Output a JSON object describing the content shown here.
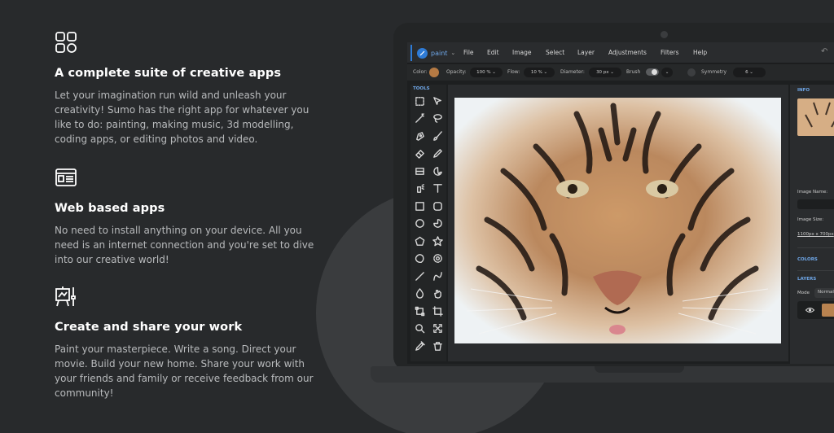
{
  "features": [
    {
      "icon": "grid-apps-icon",
      "title": "A complete suite of creative apps",
      "text": "Let your imagination run wild and unleash your creativity! Sumo has the right app for whatever you like to do: painting, making music, 3d modelling, coding apps, or editing photos and video."
    },
    {
      "icon": "browser-window-icon",
      "title": "Web based apps",
      "text": "No need to install anything on your device. All you need is an internet connection and you're set to dive into our creative world!"
    },
    {
      "icon": "easel-brush-icon",
      "title": "Create and share your work",
      "text": "Paint your masterpiece. Write a song. Direct your movie. Build your new home. Share your work with your friends and family or receive feedback from our community!"
    }
  ],
  "app": {
    "name": "paint",
    "menu": [
      "File",
      "Edit",
      "Image",
      "Select",
      "Layer",
      "Adjustments",
      "Filters",
      "Help"
    ]
  },
  "options": {
    "color_label": "Color:",
    "color": "#b57a44",
    "opacity_label": "Opacity:",
    "opacity_value": "100",
    "flow_label": "Flow:",
    "flow_value": "10",
    "diameter_label": "Diameter:",
    "diameter_value": "30",
    "brush_label": "Brush",
    "symmetry_label": "Symmetry",
    "symmetry_value": "6"
  },
  "tools_title": "TOOLS",
  "tools": [
    "marquee-select-icon",
    "pointer-arrow-icon",
    "magic-wand-icon",
    "lasso-icon",
    "pen-nib-icon",
    "paintbrush-icon",
    "eraser-icon",
    "pencil-icon",
    "gradient-icon",
    "palette-fill-icon",
    "spray-icon",
    "text-tool-icon",
    "rectangle-icon",
    "rounded-rectangle-icon",
    "ellipse-icon",
    "pie-shape-icon",
    "pentagon-icon",
    "star-shape-icon",
    "blob-shape-icon",
    "gear-shape-icon",
    "line-icon",
    "curve-icon",
    "blur-drop-icon",
    "hand-pan-icon",
    "transform-icon",
    "crop-icon",
    "zoom-icon",
    "fit-screen-icon",
    "eyedropper-icon",
    "trash-icon"
  ],
  "info_panel": {
    "info_label": "INFO",
    "image_name_label": "Image Name:",
    "image_size_label": "Image Size:",
    "image_size_value": "1100px x 700px",
    "colors_label": "COLORS",
    "layers_label": "LAYERS",
    "mode_label": "Mode",
    "mode_value": "Normal"
  },
  "colors": {
    "accent": "#2e7bd6",
    "background": "#282a2c"
  }
}
